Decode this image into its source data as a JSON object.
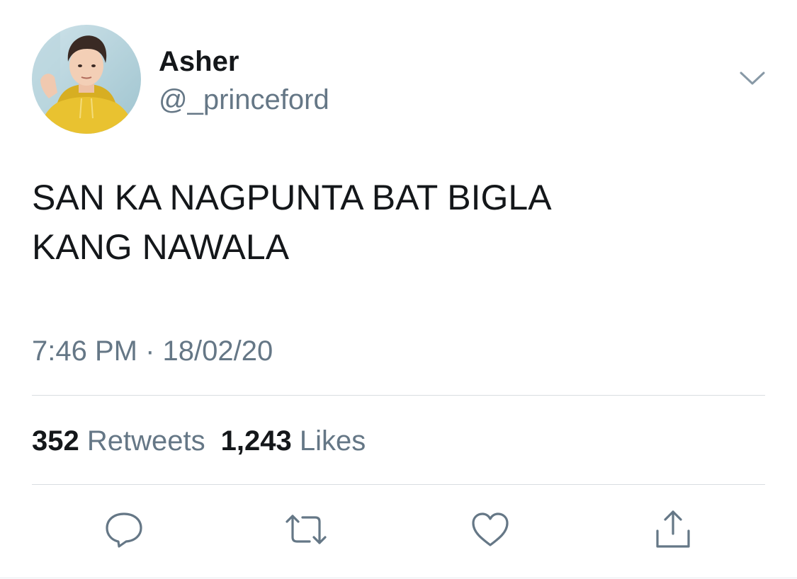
{
  "author": {
    "display_name": "Asher",
    "handle": "@_princeford"
  },
  "tweet": {
    "lines": [
      "SAN KA NAGPUNTA BAT BIGLA",
      "KANG NAWALA"
    ]
  },
  "meta": {
    "timestamp": "7:46 PM · 18/02/20"
  },
  "stats": {
    "retweets_count": "352",
    "retweets_label": "Retweets",
    "likes_count": "1,243",
    "likes_label": "Likes"
  },
  "actions": [
    {
      "icon": "reply-icon"
    },
    {
      "icon": "retweet-icon"
    },
    {
      "icon": "heart-icon"
    },
    {
      "icon": "share-icon"
    }
  ],
  "colors": {
    "primary_text": "#14171a",
    "secondary_text": "#657786",
    "divider": "#d9dde1",
    "avatar_hoodie": "#e9c230"
  }
}
